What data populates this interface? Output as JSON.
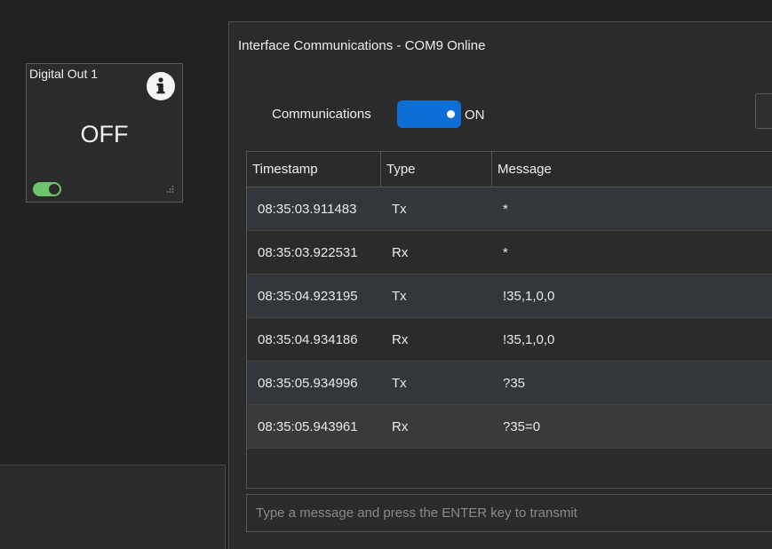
{
  "widget": {
    "title": "Digital Out 1",
    "state": "OFF",
    "toggle_color": "#6cc56c",
    "info_icon": "info-icon"
  },
  "dialog": {
    "title": "Interface Communications - COM9 Online",
    "comm_label": "Communications",
    "comm_state": "ON",
    "toggle_color": "#0d6fd6",
    "table": {
      "headers": [
        "Timestamp",
        "Type",
        "Message"
      ],
      "rows": [
        {
          "timestamp": "08:35:03.911483",
          "type": "Tx",
          "message": "*"
        },
        {
          "timestamp": "08:35:03.922531",
          "type": "Rx",
          "message": "*"
        },
        {
          "timestamp": "08:35:04.923195",
          "type": "Tx",
          "message": "!35,1,0,0"
        },
        {
          "timestamp": "08:35:04.934186",
          "type": "Rx",
          "message": "!35,1,0,0"
        },
        {
          "timestamp": "08:35:05.934996",
          "type": "Tx",
          "message": "?35"
        },
        {
          "timestamp": "08:35:05.943961",
          "type": "Rx",
          "message": "?35=0"
        }
      ]
    },
    "input": {
      "value": "",
      "placeholder": "Type a message and press the ENTER key to transmit"
    }
  }
}
